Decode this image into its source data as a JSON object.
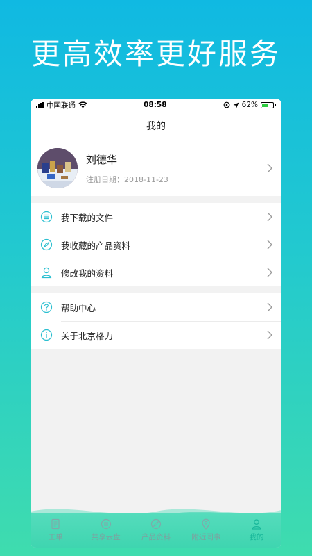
{
  "headline": "更高效率更好服务",
  "status": {
    "carrier": "中国联通",
    "time": "08:58",
    "battery": "62%"
  },
  "nav": {
    "title": "我的"
  },
  "profile": {
    "name": "刘德华",
    "date": "注册日期：2018-11-23"
  },
  "menu1": [
    {
      "label": "我下载的文件",
      "icon": "list-icon"
    },
    {
      "label": "我收藏的产品资料",
      "icon": "compass-icon"
    },
    {
      "label": "修改我的资料",
      "icon": "user-icon"
    }
  ],
  "menu2": [
    {
      "label": "帮助中心",
      "icon": "help-icon"
    },
    {
      "label": "关于北京格力",
      "icon": "info-icon"
    }
  ],
  "tabs": [
    {
      "label": "工单",
      "icon": "document-icon"
    },
    {
      "label": "共享云盘",
      "icon": "list-icon"
    },
    {
      "label": "产品资料",
      "icon": "compass-icon"
    },
    {
      "label": "附近同事",
      "icon": "location-icon"
    },
    {
      "label": "我的",
      "icon": "user-icon"
    }
  ],
  "colors": {
    "accent": "#18b79a",
    "icon": "#2bbfd0"
  }
}
